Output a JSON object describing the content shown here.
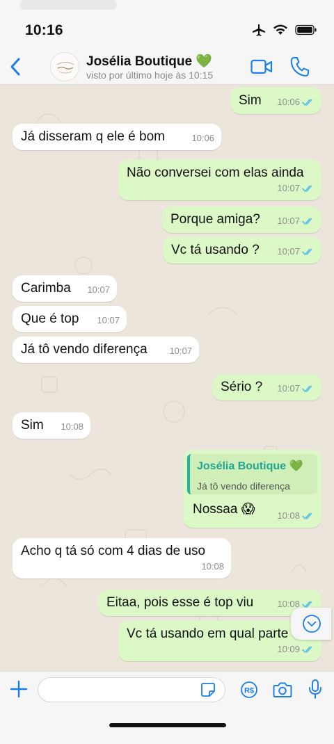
{
  "status_bar": {
    "time": "10:16"
  },
  "header": {
    "contact_name": "Josélia Boutique 💚",
    "last_seen": "visto por último hoje às 10:15"
  },
  "messages": [
    {
      "dir": "out",
      "text": "Sim",
      "time": "10:06"
    },
    {
      "dir": "in",
      "text": "Já disseram q ele é bom",
      "time": "10:06"
    },
    {
      "dir": "out",
      "text": "Não conversei com elas ainda",
      "time": "10:07"
    },
    {
      "dir": "out",
      "text": "Porque amiga?",
      "time": "10:07"
    },
    {
      "dir": "out",
      "text": "Vc tá usando ?",
      "time": "10:07"
    },
    {
      "dir": "in",
      "text": "Carimba",
      "time": "10:07"
    },
    {
      "dir": "in",
      "text": "Que é top",
      "time": "10:07"
    },
    {
      "dir": "in",
      "text": "Já tô vendo diferença",
      "time": "10:07"
    },
    {
      "dir": "out",
      "text": "Sério ?",
      "time": "10:07"
    },
    {
      "dir": "in",
      "text": "Sim",
      "time": "10:08"
    },
    {
      "dir": "out",
      "text": "Nossaa 😱",
      "time": "10:08",
      "reply": {
        "name": "Josélia Boutique 💚",
        "text": "Já tô vendo diferença"
      }
    },
    {
      "dir": "in",
      "text": "Acho q tá só com 4 dias de uso",
      "time": "10:08"
    },
    {
      "dir": "out",
      "text": "Eitaa, pois esse é top viu",
      "time": "10:08"
    },
    {
      "dir": "out",
      "text": "Vc tá usando em qual parte",
      "time": "10:09"
    }
  ],
  "input": {
    "placeholder": ""
  },
  "colors": {
    "accent": "#1a7ee6",
    "out_bubble": "#dbf8c6",
    "in_bubble": "#ffffff",
    "wallpaper": "#ece5dc",
    "tick_read": "#53bdeb"
  },
  "icons": [
    "back-icon",
    "video-call-icon",
    "phone-call-icon",
    "plus-icon",
    "sticker-icon",
    "payment-icon",
    "camera-icon",
    "mic-icon",
    "scroll-down-icon"
  ]
}
